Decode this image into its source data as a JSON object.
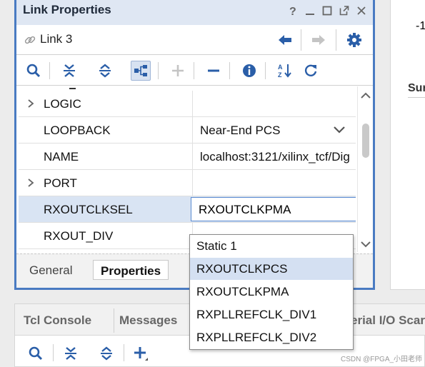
{
  "window": {
    "title": "Link Properties",
    "object_name": "Link 3",
    "title_buttons": [
      "help-icon",
      "minimize-icon",
      "maximize-icon",
      "float-icon",
      "close-icon"
    ]
  },
  "properties": [
    {
      "key": "LOGIC",
      "value": "",
      "expandable": true
    },
    {
      "key": "LOOPBACK",
      "value": "Near-End PCS",
      "has_dropdown": true
    },
    {
      "key": "NAME",
      "value": "localhost:3121/xilinx_tcf/Dig"
    },
    {
      "key": "PORT",
      "value": "",
      "expandable": true
    },
    {
      "key": "RXOUTCLKSEL",
      "value": "RXOUTCLKPMA",
      "selected": true,
      "editing": true
    },
    {
      "key": "RXOUT_DIV",
      "value": ""
    }
  ],
  "dropdown": {
    "options": [
      "Static 1",
      "RXOUTCLKPCS",
      "RXOUTCLKPMA",
      "RXPLLREFCLK_DIV1",
      "RXPLLREFCLK_DIV2"
    ],
    "highlighted": "RXOUTCLKPCS"
  },
  "tabs": {
    "general": "General",
    "properties": "Properties",
    "active": "Properties"
  },
  "right_panel": {
    "value": "-1",
    "heading": "Sur"
  },
  "bottom": {
    "tabs": [
      "Tcl Console",
      "Messages",
      "erial I/O Scar"
    ]
  },
  "watermark": "CSDN @FPGA_小田老师",
  "colors": {
    "accent": "#4a7bc2",
    "selection": "#d9e4f3",
    "icon_blue": "#2a5ea8"
  }
}
